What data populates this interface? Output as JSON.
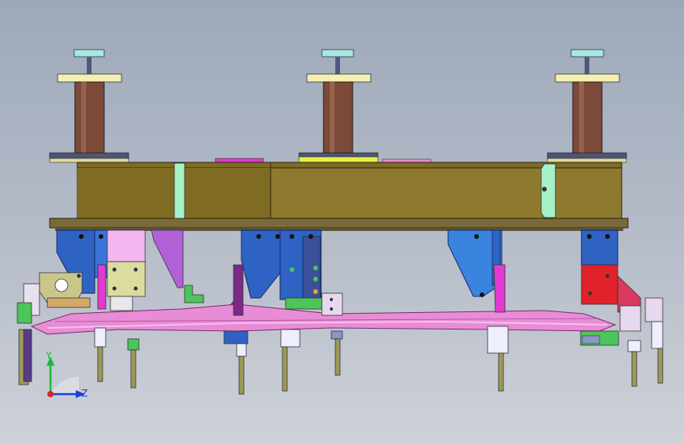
{
  "viewport": {
    "background_top": "#9da8b9",
    "background_bottom": "#cdd1d8"
  },
  "triad": {
    "y_label": "Y",
    "z_label": "Z",
    "y_color": "#1fb83a",
    "z_color": "#1c3fd6",
    "x_color": "#d8262a"
  },
  "colors": {
    "beam": "#8e7a2e",
    "beam_dark": "#6e5c20",
    "column": "#7b4a38",
    "plate_light": "#f4f0b4",
    "cap": "#a6e8e6",
    "blue_bracket": "#2e63c4",
    "pink_rail": "#e98cd6",
    "magenta": "#e23ad0",
    "red_block": "#e0232a",
    "green": "#4cc55a",
    "olive_pin": "#9d9a58",
    "mint_clamp": "#9ff2c8"
  }
}
